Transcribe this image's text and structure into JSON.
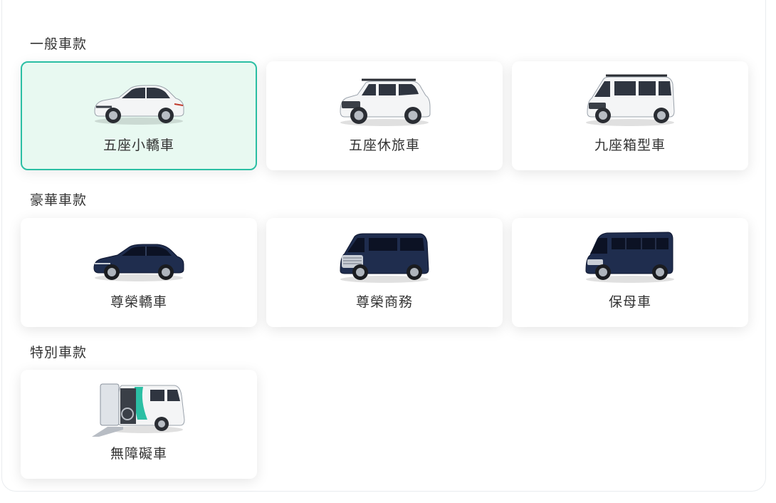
{
  "sections": [
    {
      "title": "一般車款",
      "items": [
        {
          "label": "五座小轎車",
          "icon": "sedan-icon",
          "selected": true
        },
        {
          "label": "五座休旅車",
          "icon": "suv-icon",
          "selected": false
        },
        {
          "label": "九座箱型車",
          "icon": "van-icon",
          "selected": false
        }
      ]
    },
    {
      "title": "豪華車款",
      "items": [
        {
          "label": "尊榮轎車",
          "icon": "luxury-sedan-icon",
          "selected": false
        },
        {
          "label": "尊榮商務",
          "icon": "luxury-mpv-icon",
          "selected": false
        },
        {
          "label": "保母車",
          "icon": "minibus-icon",
          "selected": false
        }
      ]
    },
    {
      "title": "特別車款",
      "items": [
        {
          "label": "無障礙車",
          "icon": "wheelchair-van-icon",
          "selected": false
        }
      ]
    }
  ],
  "colors": {
    "accent": "#2bbfa4",
    "selected_bg": "#e8f9f1",
    "text": "#333333",
    "white_car": "#f4f5f6",
    "navy_car": "#1f2d4e"
  }
}
